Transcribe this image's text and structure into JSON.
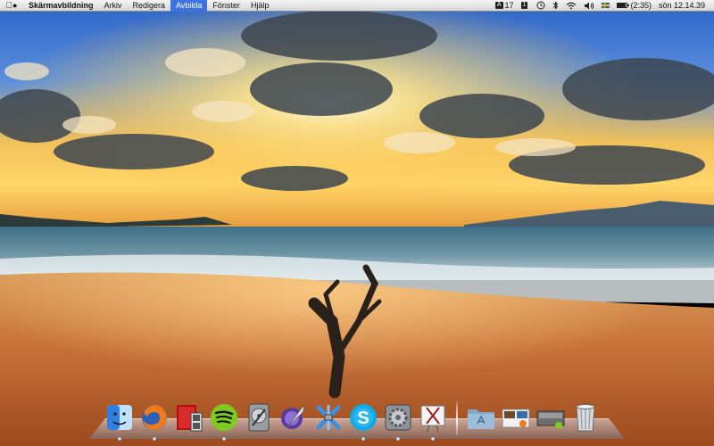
{
  "menubar": {
    "apple_icon": "apple-icon",
    "app_name": "Skärmavbildning",
    "menus": [
      "Arkiv",
      "Redigera",
      "Avbilda",
      "Fönster",
      "Hjälp"
    ],
    "active_menu": "Avbilda",
    "status": {
      "font_badge": "A",
      "font_size": "17",
      "keyboard_badge": "1",
      "battery_text": "(2:35)",
      "clock": "sön 12.14.39",
      "battery_level": 0.85
    }
  },
  "dock": {
    "apps": [
      {
        "name": "finder",
        "icon": "finder-icon",
        "running": true
      },
      {
        "name": "firefox",
        "icon": "firefox-icon",
        "running": true
      },
      {
        "name": "photo-booth",
        "icon": "photo-booth-icon",
        "running": false
      },
      {
        "name": "spotify",
        "icon": "spotify-icon",
        "running": true
      },
      {
        "name": "disk-utility",
        "icon": "disk-utility-icon",
        "running": false
      },
      {
        "name": "mail",
        "icon": "quill-icon",
        "running": false
      },
      {
        "name": "xcode",
        "icon": "xcode-icon",
        "running": false
      },
      {
        "name": "skype",
        "icon": "skype-icon",
        "running": true
      },
      {
        "name": "system-preferences",
        "icon": "gear-icon",
        "running": true
      },
      {
        "name": "grab",
        "icon": "scissors-icon",
        "running": true
      }
    ],
    "stacks": [
      {
        "name": "applications-folder",
        "icon": "applications-folder-icon"
      },
      {
        "name": "downloads-stack",
        "icon": "downloads-stack-icon"
      },
      {
        "name": "documents-stack",
        "icon": "documents-stack-icon"
      },
      {
        "name": "trash",
        "icon": "trash-icon"
      }
    ]
  }
}
